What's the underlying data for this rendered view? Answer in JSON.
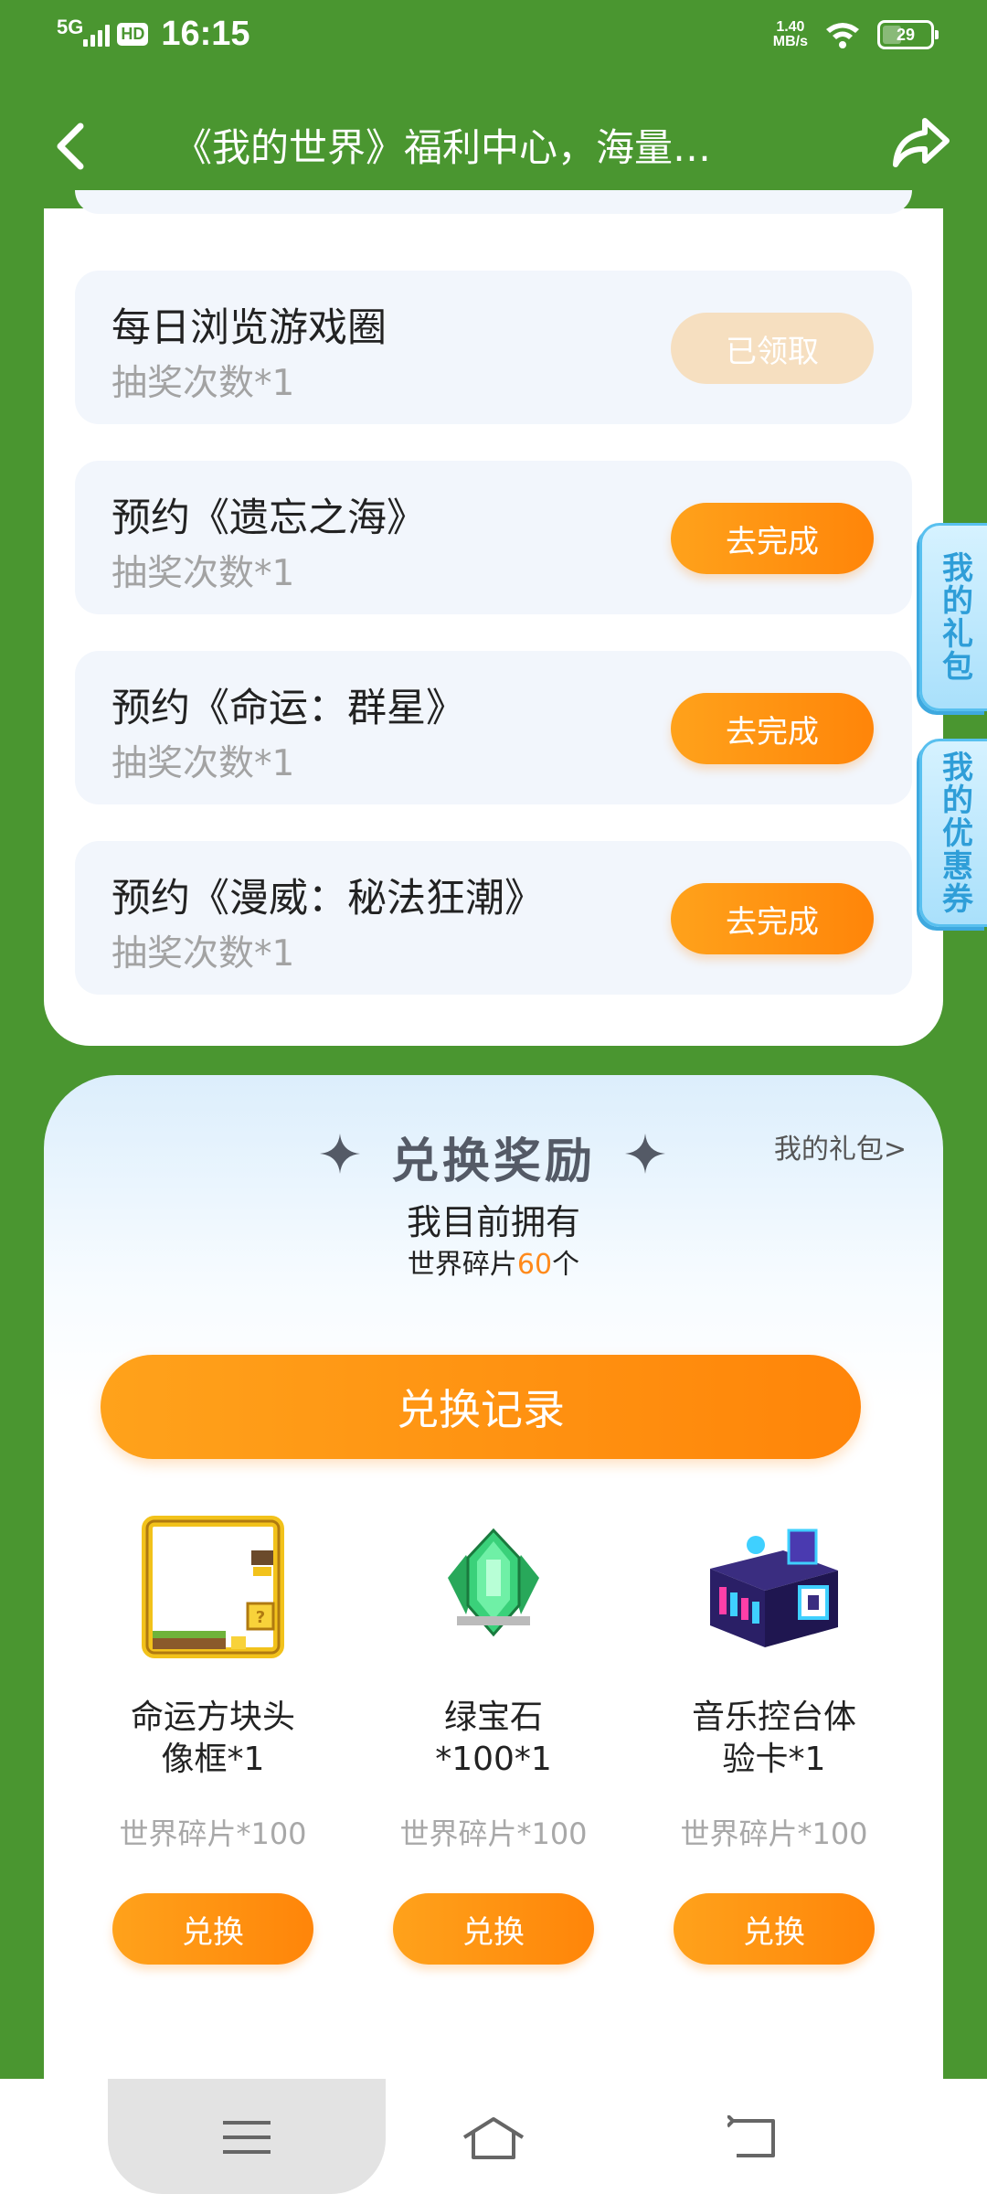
{
  "status_bar": {
    "network": "5G",
    "hd": "HD",
    "time": "16:15",
    "speed_value": "1.40",
    "speed_unit": "MB/s",
    "battery": "29"
  },
  "header": {
    "title": "《我的世界》福利中心，海量…"
  },
  "tasks": [
    {
      "name": "每日浏览游戏圈",
      "sub": "抽奖次数*1",
      "button": "已领取",
      "state": "done"
    },
    {
      "name": "预约《遗忘之海》",
      "sub": "抽奖次数*1",
      "button": "去完成",
      "state": "todo"
    },
    {
      "name": "预约《命运：群星》",
      "sub": "抽奖次数*1",
      "button": "去完成",
      "state": "todo"
    },
    {
      "name": "预约《漫威：秘法狂潮》",
      "sub": "抽奖次数*1",
      "button": "去完成",
      "state": "todo"
    }
  ],
  "side_tabs": {
    "gifts": "我的礼包",
    "coupons": "我的优惠券"
  },
  "exchange": {
    "title": "兑换奖励",
    "my_gifts_link": "我的礼包>",
    "own_title": "我目前拥有",
    "own_prefix": "世界碎片",
    "own_count": "60",
    "own_suffix": "个",
    "record_button": "兑换记录",
    "rewards": [
      {
        "name_line1": "命运方块头",
        "name_line2": "像框*1",
        "cost": "世界碎片*100",
        "button": "兑换",
        "icon": "avatar-frame-icon"
      },
      {
        "name_line1": "绿宝石",
        "name_line2": "*100*1",
        "cost": "世界碎片*100",
        "button": "兑换",
        "icon": "emerald-icon"
      },
      {
        "name_line1": "音乐控台体",
        "name_line2": "验卡*1",
        "cost": "世界碎片*100",
        "button": "兑换",
        "icon": "music-console-icon"
      }
    ]
  },
  "colors": {
    "background": "#4a9630",
    "accent": "#ff8a1c",
    "done_button": "#f6dfc0",
    "side_tab": "#a9e0fb"
  }
}
